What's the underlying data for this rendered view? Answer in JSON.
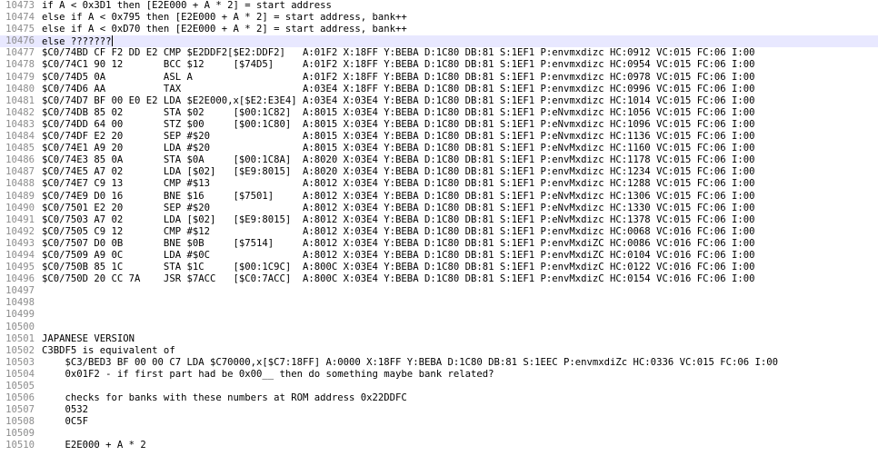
{
  "editor": {
    "current_line_number": "10476",
    "lines": [
      {
        "n": "10473",
        "t": "if A < 0x3D1 then [E2E000 + A * 2] = start address"
      },
      {
        "n": "10474",
        "t": "else if A < 0x795 then [E2E000 + A * 2] = start address, bank++"
      },
      {
        "n": "10475",
        "t": "else if A < 0xD70 then [E2E000 + A * 2] = start address, bank++"
      },
      {
        "n": "10476",
        "t": "else ???????"
      },
      {
        "n": "10477",
        "t": "$C0/74BD CF F2 DD E2 CMP $E2DDF2[$E2:DDF2]   A:01F2 X:18FF Y:BEBA D:1C80 DB:81 S:1EF1 P:envmxdizc HC:0912 VC:015 FC:06 I:00"
      },
      {
        "n": "10478",
        "t": "$C0/74C1 90 12       BCC $12     [$74D5]     A:01F2 X:18FF Y:BEBA D:1C80 DB:81 S:1EF1 P:envmxdizc HC:0954 VC:015 FC:06 I:00"
      },
      {
        "n": "10479",
        "t": "$C0/74D5 0A          ASL A                   A:01F2 X:18FF Y:BEBA D:1C80 DB:81 S:1EF1 P:envmxdizc HC:0978 VC:015 FC:06 I:00"
      },
      {
        "n": "10480",
        "t": "$C0/74D6 AA          TAX                     A:03E4 X:18FF Y:BEBA D:1C80 DB:81 S:1EF1 P:envmxdizc HC:0996 VC:015 FC:06 I:00"
      },
      {
        "n": "10481",
        "t": "$C0/74D7 BF 00 E0 E2 LDA $E2E000,x[$E2:E3E4] A:03E4 X:03E4 Y:BEBA D:1C80 DB:81 S:1EF1 P:envmxdizc HC:1014 VC:015 FC:06 I:00"
      },
      {
        "n": "10482",
        "t": "$C0/74DB 85 02       STA $02     [$00:1C82]  A:8015 X:03E4 Y:BEBA D:1C80 DB:81 S:1EF1 P:eNvmxdizc HC:1056 VC:015 FC:06 I:00"
      },
      {
        "n": "10483",
        "t": "$C0/74DD 64 00       STZ $00     [$00:1C80]  A:8015 X:03E4 Y:BEBA D:1C80 DB:81 S:1EF1 P:eNvmxdizc HC:1096 VC:015 FC:06 I:00"
      },
      {
        "n": "10484",
        "t": "$C0/74DF E2 20       SEP #$20                A:8015 X:03E4 Y:BEBA D:1C80 DB:81 S:1EF1 P:eNvmxdizc HC:1136 VC:015 FC:06 I:00"
      },
      {
        "n": "10485",
        "t": "$C0/74E1 A9 20       LDA #$20                A:8015 X:03E4 Y:BEBA D:1C80 DB:81 S:1EF1 P:eNvMxdizc HC:1160 VC:015 FC:06 I:00"
      },
      {
        "n": "10486",
        "t": "$C0/74E3 85 0A       STA $0A     [$00:1C8A]  A:8020 X:03E4 Y:BEBA D:1C80 DB:81 S:1EF1 P:envMxdizc HC:1178 VC:015 FC:06 I:00"
      },
      {
        "n": "10487",
        "t": "$C0/74E5 A7 02       LDA [$02]   [$E9:8015]  A:8020 X:03E4 Y:BEBA D:1C80 DB:81 S:1EF1 P:envMxdizc HC:1234 VC:015 FC:06 I:00"
      },
      {
        "n": "10488",
        "t": "$C0/74E7 C9 13       CMP #$13                A:8012 X:03E4 Y:BEBA D:1C80 DB:81 S:1EF1 P:envMxdizc HC:1288 VC:015 FC:06 I:00"
      },
      {
        "n": "10489",
        "t": "$C0/74E9 D0 16       BNE $16     [$7501]     A:8012 X:03E4 Y:BEBA D:1C80 DB:81 S:1EF1 P:eNvMxdizc HC:1306 VC:015 FC:06 I:00"
      },
      {
        "n": "10490",
        "t": "$C0/7501 E2 20       SEP #$20                A:8012 X:03E4 Y:BEBA D:1C80 DB:81 S:1EF1 P:eNvMxdizc HC:1330 VC:015 FC:06 I:00"
      },
      {
        "n": "10491",
        "t": "$C0/7503 A7 02       LDA [$02]   [$E9:8015]  A:8012 X:03E4 Y:BEBA D:1C80 DB:81 S:1EF1 P:eNvMxdizc HC:1378 VC:015 FC:06 I:00"
      },
      {
        "n": "10492",
        "t": "$C0/7505 C9 12       CMP #$12                A:8012 X:03E4 Y:BEBA D:1C80 DB:81 S:1EF1 P:envMxdizc HC:0068 VC:016 FC:06 I:00"
      },
      {
        "n": "10493",
        "t": "$C0/7507 D0 0B       BNE $0B     [$7514]     A:8012 X:03E4 Y:BEBA D:1C80 DB:81 S:1EF1 P:envMxdiZC HC:0086 VC:016 FC:06 I:00"
      },
      {
        "n": "10494",
        "t": "$C0/7509 A9 0C       LDA #$0C                A:8012 X:03E4 Y:BEBA D:1C80 DB:81 S:1EF1 P:envMxdiZC HC:0104 VC:016 FC:06 I:00"
      },
      {
        "n": "10495",
        "t": "$C0/750B 85 1C       STA $1C     [$00:1C9C]  A:800C X:03E4 Y:BEBA D:1C80 DB:81 S:1EF1 P:envMxdizC HC:0122 VC:016 FC:06 I:00"
      },
      {
        "n": "10496",
        "t": "$C0/750D 20 CC 7A    JSR $7ACC   [$C0:7ACC]  A:800C X:03E4 Y:BEBA D:1C80 DB:81 S:1EF1 P:envMxdizC HC:0154 VC:016 FC:06 I:00"
      },
      {
        "n": "10497",
        "t": ""
      },
      {
        "n": "10498",
        "t": ""
      },
      {
        "n": "10499",
        "t": ""
      },
      {
        "n": "10500",
        "t": ""
      },
      {
        "n": "10501",
        "t": "JAPANESE VERSION"
      },
      {
        "n": "10502",
        "t": "C3BDF5 is equivalent of"
      },
      {
        "n": "10503",
        "t": "    $C3/BED3 BF 00 00 C7 LDA $C70000,x[$C7:18FF] A:0000 X:18FF Y:BEBA D:1C80 DB:81 S:1EEC P:envmxdiZc HC:0336 VC:015 FC:06 I:00"
      },
      {
        "n": "10504",
        "t": "    0x01F2 - if first part had be 0x00__ then do something maybe bank related?"
      },
      {
        "n": "10505",
        "t": ""
      },
      {
        "n": "10506",
        "t": "    checks for banks with these numbers at ROM address 0x22DDFC"
      },
      {
        "n": "10507",
        "t": "    0532"
      },
      {
        "n": "10508",
        "t": "    0C5F"
      },
      {
        "n": "10509",
        "t": ""
      },
      {
        "n": "10510",
        "t": "    E2E000 + A * 2"
      }
    ]
  }
}
